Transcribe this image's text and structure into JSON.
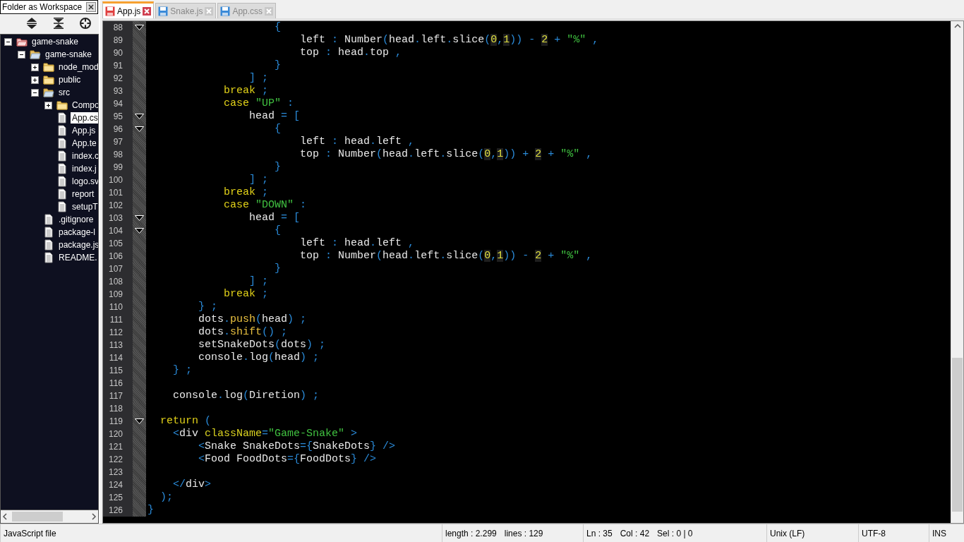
{
  "sidebar": {
    "title": "Folder as Workspace",
    "tree": [
      {
        "label": "game-snake",
        "kind": "project",
        "expanded": true,
        "selected": false,
        "children": [
          {
            "label": "game-snake",
            "kind": "folder",
            "expanded": true,
            "selected": false,
            "children": [
              {
                "label": "node_mod",
                "kind": "folder",
                "expanded": false,
                "selected": false
              },
              {
                "label": "public",
                "kind": "folder",
                "expanded": false,
                "selected": false
              },
              {
                "label": "src",
                "kind": "folder",
                "expanded": true,
                "selected": false,
                "children": [
                  {
                    "label": "Compo",
                    "kind": "folder",
                    "expanded": false,
                    "selected": false
                  },
                  {
                    "label": "App.cs",
                    "kind": "file",
                    "selected": true
                  },
                  {
                    "label": "App.js",
                    "kind": "file",
                    "selected": false
                  },
                  {
                    "label": "App.te",
                    "kind": "file",
                    "selected": false
                  },
                  {
                    "label": "index.c",
                    "kind": "file",
                    "selected": false
                  },
                  {
                    "label": "index.j",
                    "kind": "file",
                    "selected": false
                  },
                  {
                    "label": "logo.sv",
                    "kind": "file",
                    "selected": false
                  },
                  {
                    "label": "report",
                    "kind": "file",
                    "selected": false
                  },
                  {
                    "label": "setupT",
                    "kind": "file",
                    "selected": false
                  }
                ]
              },
              {
                "label": ".gitignore",
                "kind": "file",
                "selected": false
              },
              {
                "label": "package-l",
                "kind": "file",
                "selected": false
              },
              {
                "label": "package.js",
                "kind": "file",
                "selected": false
              },
              {
                "label": "README.",
                "kind": "file",
                "selected": false
              }
            ]
          }
        ]
      }
    ]
  },
  "tabs": [
    {
      "label": "App.js",
      "selected": true,
      "modified": true
    },
    {
      "label": "Snake.js",
      "selected": false,
      "modified": false
    },
    {
      "label": "App.css",
      "selected": false,
      "modified": false
    }
  ],
  "editor": {
    "lines": [
      {
        "number": "88",
        "fold": true,
        "tokens": [
          {
            "kind": "op",
            "text": "                    {"
          }
        ]
      },
      {
        "number": "89",
        "fold": false,
        "tokens": [
          {
            "kind": "id",
            "text": "                        left"
          },
          {
            "kind": "op",
            "text": " : "
          },
          {
            "kind": "id",
            "text": "Number"
          },
          {
            "kind": "op",
            "text": "("
          },
          {
            "kind": "id",
            "text": "head"
          },
          {
            "kind": "op",
            "text": "."
          },
          {
            "kind": "id",
            "text": "left"
          },
          {
            "kind": "op",
            "text": "."
          },
          {
            "kind": "id",
            "text": "slice"
          },
          {
            "kind": "op",
            "text": "("
          },
          {
            "kind": "num",
            "text": "0"
          },
          {
            "kind": "op",
            "text": ","
          },
          {
            "kind": "num",
            "text": "1"
          },
          {
            "kind": "op",
            "text": ")) - "
          },
          {
            "kind": "num",
            "text": "2"
          },
          {
            "kind": "op",
            "text": " + "
          },
          {
            "kind": "str",
            "text": "\"%\""
          },
          {
            "kind": "op",
            "text": " ,"
          }
        ]
      },
      {
        "number": "90",
        "fold": false,
        "tokens": [
          {
            "kind": "id",
            "text": "                        top"
          },
          {
            "kind": "op",
            "text": " : "
          },
          {
            "kind": "id",
            "text": "head"
          },
          {
            "kind": "op",
            "text": "."
          },
          {
            "kind": "id",
            "text": "top"
          },
          {
            "kind": "op",
            "text": " ,"
          }
        ]
      },
      {
        "number": "91",
        "fold": false,
        "tokens": [
          {
            "kind": "op",
            "text": "                    }"
          }
        ]
      },
      {
        "number": "92",
        "fold": false,
        "tokens": [
          {
            "kind": "op",
            "text": "                ] ;"
          }
        ]
      },
      {
        "number": "93",
        "fold": false,
        "tokens": [
          {
            "kind": "kw",
            "text": "            break"
          },
          {
            "kind": "op",
            "text": " ;"
          }
        ]
      },
      {
        "number": "94",
        "fold": false,
        "tokens": [
          {
            "kind": "kw",
            "text": "            case"
          },
          {
            "kind": "str",
            "text": " \"UP\""
          },
          {
            "kind": "op",
            "text": " :"
          }
        ]
      },
      {
        "number": "95",
        "fold": true,
        "tokens": [
          {
            "kind": "id",
            "text": "                head"
          },
          {
            "kind": "op",
            "text": " = ["
          }
        ]
      },
      {
        "number": "96",
        "fold": true,
        "tokens": [
          {
            "kind": "op",
            "text": "                    {"
          }
        ]
      },
      {
        "number": "97",
        "fold": false,
        "tokens": [
          {
            "kind": "id",
            "text": "                        left"
          },
          {
            "kind": "op",
            "text": " : "
          },
          {
            "kind": "id",
            "text": "head"
          },
          {
            "kind": "op",
            "text": "."
          },
          {
            "kind": "id",
            "text": "left"
          },
          {
            "kind": "op",
            "text": " ,"
          }
        ]
      },
      {
        "number": "98",
        "fold": false,
        "tokens": [
          {
            "kind": "id",
            "text": "                        top"
          },
          {
            "kind": "op",
            "text": " : "
          },
          {
            "kind": "id",
            "text": "Number"
          },
          {
            "kind": "op",
            "text": "("
          },
          {
            "kind": "id",
            "text": "head"
          },
          {
            "kind": "op",
            "text": "."
          },
          {
            "kind": "id",
            "text": "left"
          },
          {
            "kind": "op",
            "text": "."
          },
          {
            "kind": "id",
            "text": "slice"
          },
          {
            "kind": "op",
            "text": "("
          },
          {
            "kind": "num",
            "text": "0"
          },
          {
            "kind": "op",
            "text": ","
          },
          {
            "kind": "num",
            "text": "1"
          },
          {
            "kind": "op",
            "text": ")) + "
          },
          {
            "kind": "num",
            "text": "2"
          },
          {
            "kind": "op",
            "text": " + "
          },
          {
            "kind": "str",
            "text": "\"%\""
          },
          {
            "kind": "op",
            "text": " ,"
          }
        ]
      },
      {
        "number": "99",
        "fold": false,
        "tokens": [
          {
            "kind": "op",
            "text": "                    }"
          }
        ]
      },
      {
        "number": "100",
        "fold": false,
        "tokens": [
          {
            "kind": "op",
            "text": "                ] ;"
          }
        ]
      },
      {
        "number": "101",
        "fold": false,
        "tokens": [
          {
            "kind": "kw",
            "text": "            break"
          },
          {
            "kind": "op",
            "text": " ;"
          }
        ]
      },
      {
        "number": "102",
        "fold": false,
        "tokens": [
          {
            "kind": "kw",
            "text": "            case"
          },
          {
            "kind": "str",
            "text": " \"DOWN\""
          },
          {
            "kind": "op",
            "text": " :"
          }
        ]
      },
      {
        "number": "103",
        "fold": true,
        "tokens": [
          {
            "kind": "id",
            "text": "                head"
          },
          {
            "kind": "op",
            "text": " = ["
          }
        ]
      },
      {
        "number": "104",
        "fold": true,
        "tokens": [
          {
            "kind": "op",
            "text": "                    {"
          }
        ]
      },
      {
        "number": "105",
        "fold": false,
        "tokens": [
          {
            "kind": "id",
            "text": "                        left"
          },
          {
            "kind": "op",
            "text": " : "
          },
          {
            "kind": "id",
            "text": "head"
          },
          {
            "kind": "op",
            "text": "."
          },
          {
            "kind": "id",
            "text": "left"
          },
          {
            "kind": "op",
            "text": " ,"
          }
        ]
      },
      {
        "number": "106",
        "fold": false,
        "tokens": [
          {
            "kind": "id",
            "text": "                        top"
          },
          {
            "kind": "op",
            "text": " : "
          },
          {
            "kind": "id",
            "text": "Number"
          },
          {
            "kind": "op",
            "text": "("
          },
          {
            "kind": "id",
            "text": "head"
          },
          {
            "kind": "op",
            "text": "."
          },
          {
            "kind": "id",
            "text": "left"
          },
          {
            "kind": "op",
            "text": "."
          },
          {
            "kind": "id",
            "text": "slice"
          },
          {
            "kind": "op",
            "text": "("
          },
          {
            "kind": "num",
            "text": "0"
          },
          {
            "kind": "op",
            "text": ","
          },
          {
            "kind": "num",
            "text": "1"
          },
          {
            "kind": "op",
            "text": ")) - "
          },
          {
            "kind": "num",
            "text": "2"
          },
          {
            "kind": "op",
            "text": " + "
          },
          {
            "kind": "str",
            "text": "\"%\""
          },
          {
            "kind": "op",
            "text": " ,"
          }
        ]
      },
      {
        "number": "107",
        "fold": false,
        "tokens": [
          {
            "kind": "op",
            "text": "                    }"
          }
        ]
      },
      {
        "number": "108",
        "fold": false,
        "tokens": [
          {
            "kind": "op",
            "text": "                ] ;"
          }
        ]
      },
      {
        "number": "109",
        "fold": false,
        "tokens": [
          {
            "kind": "kw",
            "text": "            break"
          },
          {
            "kind": "op",
            "text": " ;"
          }
        ]
      },
      {
        "number": "110",
        "fold": false,
        "tokens": [
          {
            "kind": "op",
            "text": "        } ;"
          }
        ]
      },
      {
        "number": "111",
        "fold": false,
        "tokens": [
          {
            "kind": "id",
            "text": "        dots"
          },
          {
            "kind": "op",
            "text": "."
          },
          {
            "kind": "method",
            "text": "push"
          },
          {
            "kind": "op",
            "text": "("
          },
          {
            "kind": "id",
            "text": "head"
          },
          {
            "kind": "op",
            "text": ") ;"
          }
        ]
      },
      {
        "number": "112",
        "fold": false,
        "tokens": [
          {
            "kind": "id",
            "text": "        dots"
          },
          {
            "kind": "op",
            "text": "."
          },
          {
            "kind": "method",
            "text": "shift"
          },
          {
            "kind": "op",
            "text": "() ;"
          }
        ]
      },
      {
        "number": "113",
        "fold": false,
        "tokens": [
          {
            "kind": "id",
            "text": "        setSnakeDots"
          },
          {
            "kind": "op",
            "text": "("
          },
          {
            "kind": "id",
            "text": "dots"
          },
          {
            "kind": "op",
            "text": ") ;"
          }
        ]
      },
      {
        "number": "114",
        "fold": false,
        "tokens": [
          {
            "kind": "id",
            "text": "        console"
          },
          {
            "kind": "op",
            "text": "."
          },
          {
            "kind": "id",
            "text": "log"
          },
          {
            "kind": "op",
            "text": "("
          },
          {
            "kind": "id",
            "text": "head"
          },
          {
            "kind": "op",
            "text": ") ;"
          }
        ]
      },
      {
        "number": "115",
        "fold": false,
        "tokens": [
          {
            "kind": "op",
            "text": "    } ;"
          }
        ]
      },
      {
        "number": "116",
        "fold": false
      },
      {
        "number": "117",
        "fold": false,
        "tokens": [
          {
            "kind": "id",
            "text": "    console"
          },
          {
            "kind": "op",
            "text": "."
          },
          {
            "kind": "id",
            "text": "log"
          },
          {
            "kind": "op",
            "text": "("
          },
          {
            "kind": "id",
            "text": "Diretion"
          },
          {
            "kind": "op",
            "text": ") ;"
          }
        ]
      },
      {
        "number": "118",
        "fold": false
      },
      {
        "number": "119",
        "fold": true,
        "tokens": [
          {
            "kind": "kw",
            "text": "  return"
          },
          {
            "kind": "op",
            "text": " ("
          }
        ]
      },
      {
        "number": "120",
        "fold": false,
        "tokens": [
          {
            "kind": "op",
            "text": "    <"
          },
          {
            "kind": "id",
            "text": "div "
          },
          {
            "kind": "attr",
            "text": "className"
          },
          {
            "kind": "op",
            "text": "="
          },
          {
            "kind": "str",
            "text": "\"Game-Snake\""
          },
          {
            "kind": "op",
            "text": " >"
          }
        ]
      },
      {
        "number": "121",
        "fold": false,
        "tokens": [
          {
            "kind": "op",
            "text": "        <"
          },
          {
            "kind": "id",
            "text": "Snake SnakeDots"
          },
          {
            "kind": "op",
            "text": "={"
          },
          {
            "kind": "id",
            "text": "SnakeDots"
          },
          {
            "kind": "op",
            "text": "} />"
          }
        ]
      },
      {
        "number": "122",
        "fold": false,
        "tokens": [
          {
            "kind": "op",
            "text": "        <"
          },
          {
            "kind": "id",
            "text": "Food FoodDots"
          },
          {
            "kind": "op",
            "text": "={"
          },
          {
            "kind": "id",
            "text": "FoodDots"
          },
          {
            "kind": "op",
            "text": "} />"
          }
        ]
      },
      {
        "number": "123",
        "fold": false
      },
      {
        "number": "124",
        "fold": false,
        "tokens": [
          {
            "kind": "op",
            "text": "    </"
          },
          {
            "kind": "id",
            "text": "div"
          },
          {
            "kind": "op",
            "text": ">"
          }
        ]
      },
      {
        "number": "125",
        "fold": false,
        "tokens": [
          {
            "kind": "op",
            "text": "  );"
          }
        ]
      },
      {
        "number": "126",
        "fold": false,
        "tokens": [
          {
            "kind": "op",
            "text": "}"
          }
        ]
      }
    ]
  },
  "status_bar": [
    {
      "items": [
        "JavaScript file"
      ]
    },
    {
      "items": [
        "length : 2.299",
        "lines : 129"
      ]
    },
    {
      "items": [
        "Ln : 35",
        "Col : 42",
        "Sel : 0 | 0"
      ]
    },
    {
      "items": [
        "Unix (LF)"
      ]
    },
    {
      "items": [
        "UTF-8"
      ]
    },
    {
      "items": [
        "INS"
      ]
    }
  ]
}
